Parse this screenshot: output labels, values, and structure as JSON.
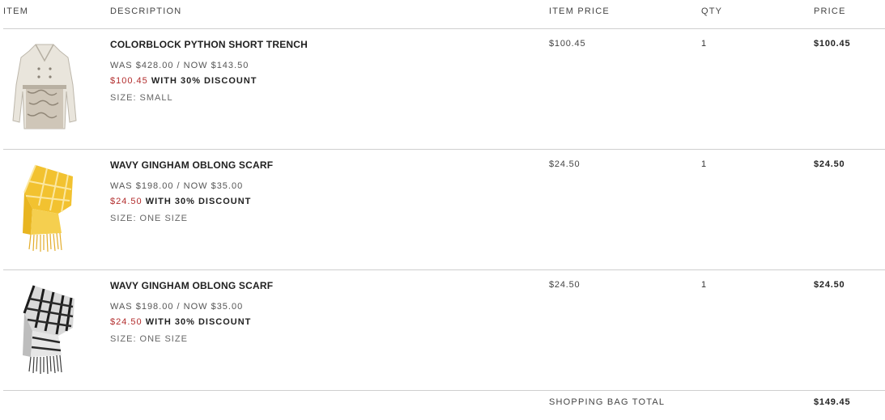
{
  "headers": {
    "item": "ITEM",
    "description": "DESCRIPTION",
    "item_price": "ITEM PRICE",
    "qty": "QTY",
    "price": "PRICE"
  },
  "items": [
    {
      "image": "trench-coat-thumbnail",
      "name": "COLORBLOCK PYTHON SHORT TRENCH",
      "was_now": "WAS $428.00 / NOW $143.50",
      "discount_price": "$100.45",
      "discount_text": "WITH 30% DISCOUNT",
      "size": "SIZE: SMALL",
      "item_price": "$100.45",
      "qty": "1",
      "price": "$100.45"
    },
    {
      "image": "yellow-scarf-thumbnail",
      "name": "WAVY GINGHAM OBLONG SCARF",
      "was_now": "WAS $198.00 / NOW $35.00",
      "discount_price": "$24.50",
      "discount_text": "WITH 30% DISCOUNT",
      "size": "SIZE: ONE SIZE",
      "item_price": "$24.50",
      "qty": "1",
      "price": "$24.50"
    },
    {
      "image": "black-white-scarf-thumbnail",
      "name": "WAVY GINGHAM OBLONG SCARF",
      "was_now": "WAS $198.00 / NOW $35.00",
      "discount_price": "$24.50",
      "discount_text": "WITH 30% DISCOUNT",
      "size": "SIZE: ONE SIZE",
      "item_price": "$24.50",
      "qty": "1",
      "price": "$24.50"
    }
  ],
  "total": {
    "label": "SHOPPING BAG TOTAL",
    "value": "$149.45"
  },
  "colors": {
    "discount_red": "#b22c2c",
    "rule": "#cfcfcf",
    "scarf_yellow": "#f2c230"
  }
}
